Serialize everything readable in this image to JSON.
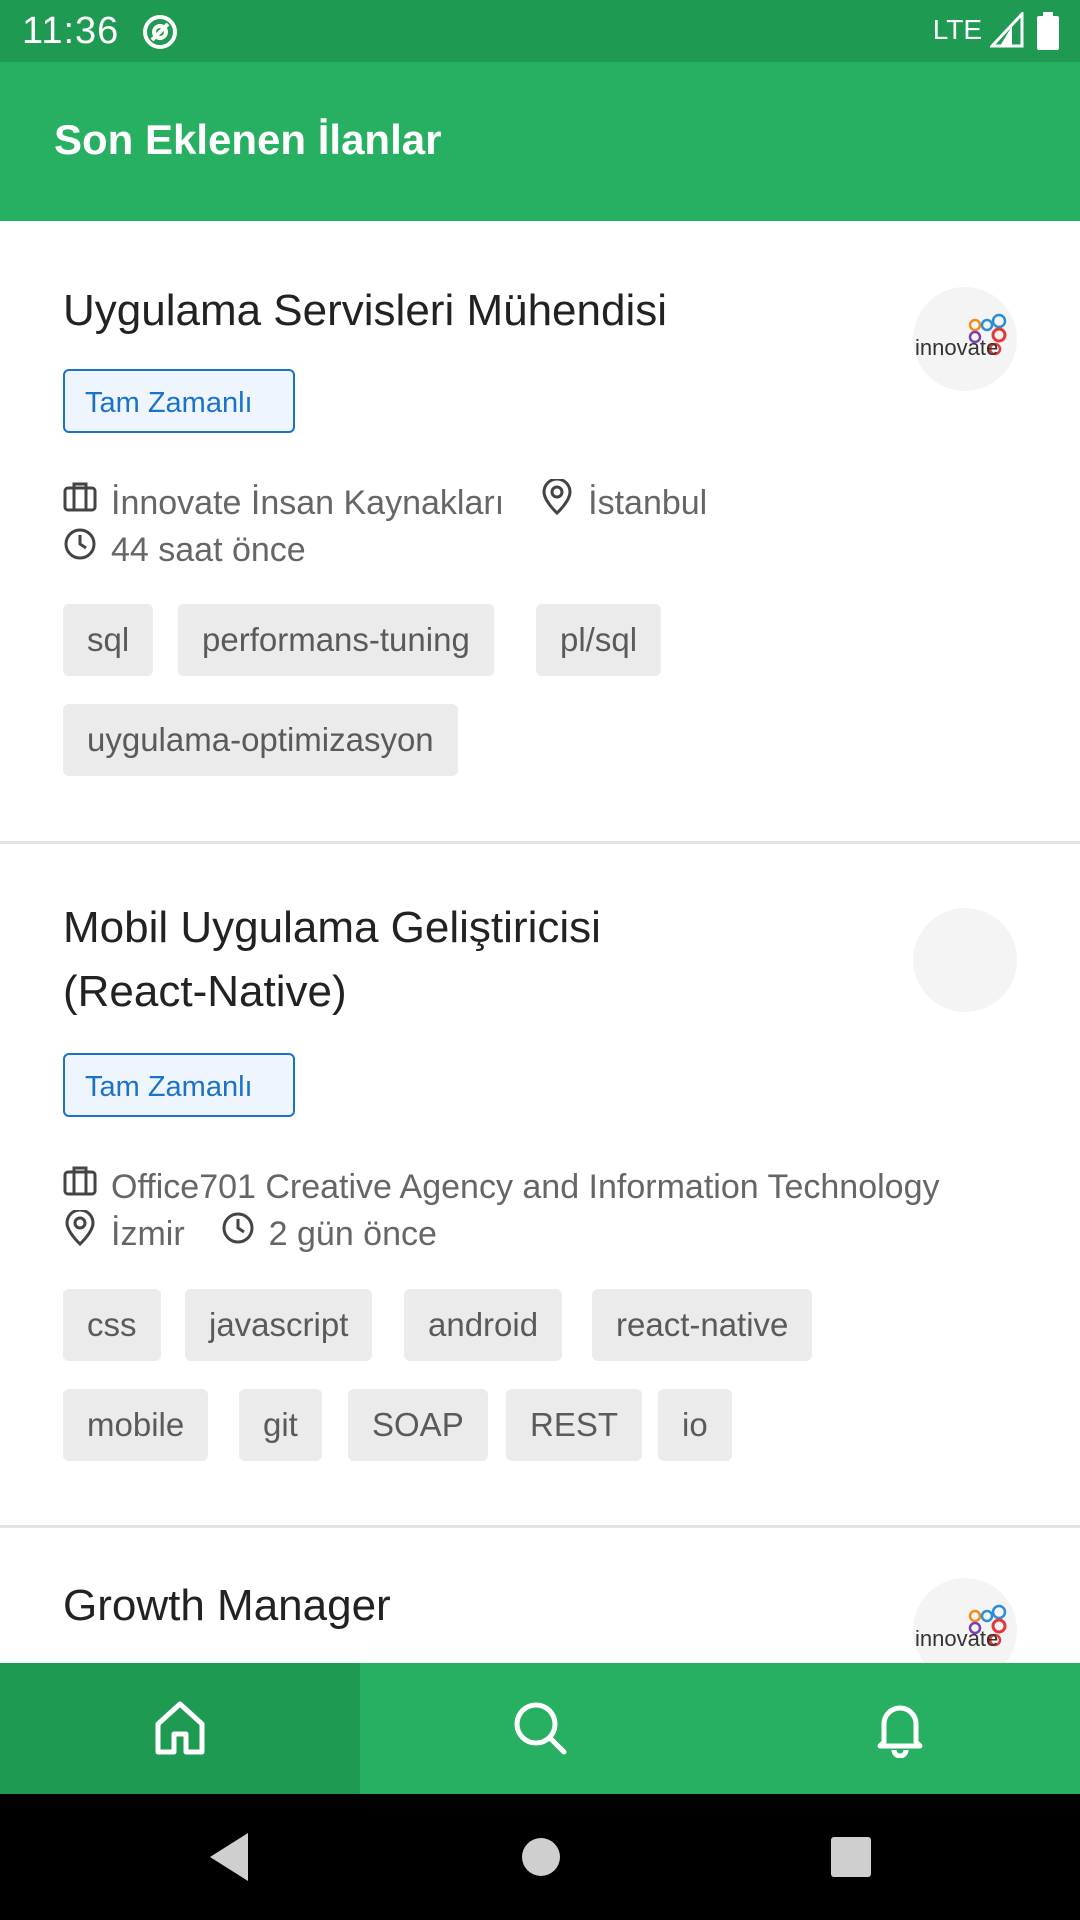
{
  "status_bar": {
    "time": "11:36",
    "network": "LTE"
  },
  "app_bar": {
    "title": "Son Eklenen İlanlar"
  },
  "jobs": [
    {
      "title": "Uygulama Servisleri Mühendisi",
      "type": "Tam Zamanlı",
      "company": "İnnovate İnsan Kaynakları",
      "location": "İstanbul",
      "posted": "44 saat önce",
      "logo_text": "innovate",
      "tags": [
        "sql",
        "performans-tuning",
        "pl/sql",
        "uygulama-optimizasyon"
      ]
    },
    {
      "title": "Mobil Uygulama Geliştiricisi (React-Native)",
      "type": "Tam Zamanlı",
      "company": "Office701 Creative Agency and Information Technology",
      "location": "İzmir",
      "posted": "2 gün önce",
      "tags": [
        "css",
        "javascript",
        "android",
        "react-native",
        "mobile",
        "git",
        "SOAP",
        "REST",
        "io"
      ]
    },
    {
      "title": "Growth Manager",
      "logo_text": "innovate"
    }
  ],
  "bottom_nav": {
    "items": [
      "home-icon",
      "search-icon",
      "bell-icon"
    ],
    "active": 0
  },
  "colors": {
    "primary": "#28b062",
    "primary_dark": "#1e9a52",
    "badge_blue": "#1a73c9"
  }
}
